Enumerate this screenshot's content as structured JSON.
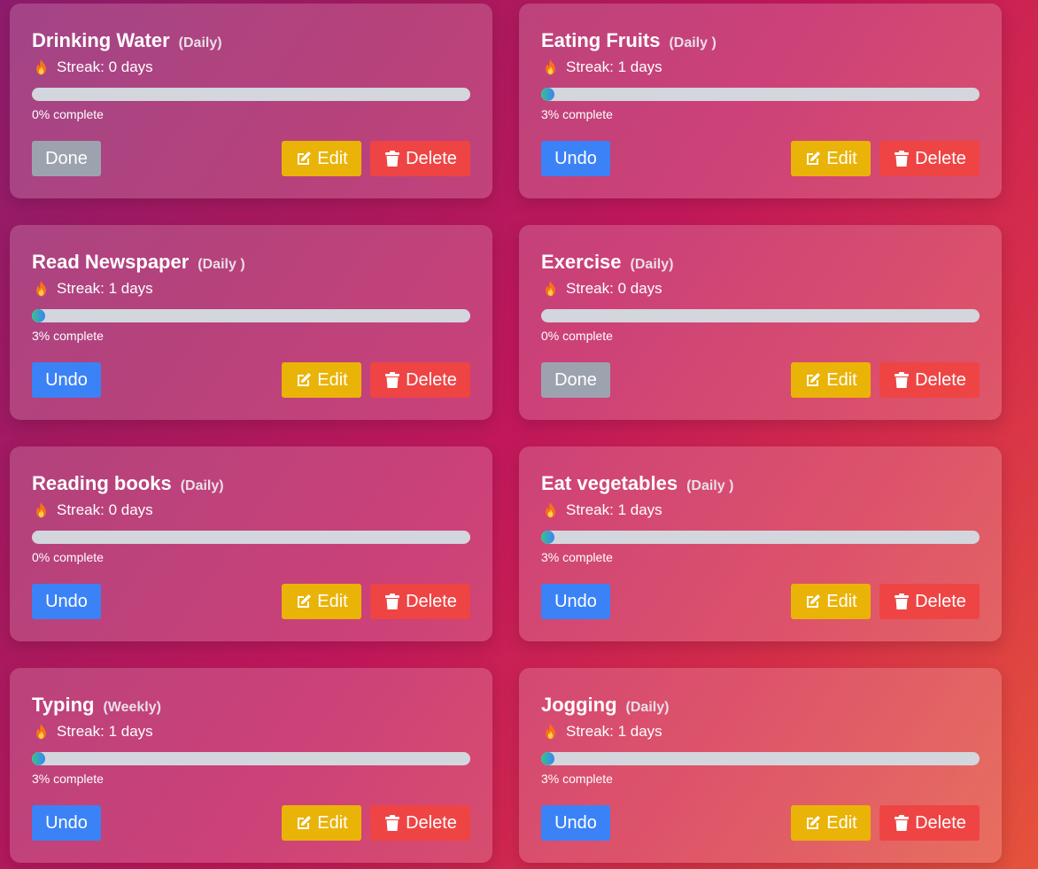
{
  "colors": {
    "done_button": "#9ca3af",
    "undo_button": "#3b82f6",
    "edit_button": "#eab308",
    "delete_button": "#ef4444",
    "progress_track": "#d3d6dc"
  },
  "icons": {
    "streak": "fire-icon",
    "edit": "edit-icon",
    "delete": "trash-icon"
  },
  "habits": [
    {
      "name": "Drinking Water",
      "frequency": "(Daily)",
      "streak": "Streak: 0 days",
      "progress": 0,
      "progress_label": "0% complete",
      "toggle_label": "Done",
      "toggle_state": "done",
      "edit_label": "Edit",
      "delete_label": "Delete"
    },
    {
      "name": "Eating Fruits",
      "frequency": "(Daily )",
      "streak": "Streak: 1 days",
      "progress": 3,
      "progress_label": "3% complete",
      "toggle_label": "Undo",
      "toggle_state": "undo",
      "edit_label": "Edit",
      "delete_label": "Delete"
    },
    {
      "name": "Read Newspaper",
      "frequency": "(Daily )",
      "streak": "Streak: 1 days",
      "progress": 3,
      "progress_label": "3% complete",
      "toggle_label": "Undo",
      "toggle_state": "undo",
      "edit_label": "Edit",
      "delete_label": "Delete"
    },
    {
      "name": "Exercise",
      "frequency": "(Daily)",
      "streak": "Streak: 0 days",
      "progress": 0,
      "progress_label": "0% complete",
      "toggle_label": "Done",
      "toggle_state": "done",
      "edit_label": "Edit",
      "delete_label": "Delete"
    },
    {
      "name": "Reading books",
      "frequency": "(Daily)",
      "streak": "Streak: 0 days",
      "progress": 0,
      "progress_label": "0% complete",
      "toggle_label": "Undo",
      "toggle_state": "undo",
      "edit_label": "Edit",
      "delete_label": "Delete"
    },
    {
      "name": "Eat vegetables",
      "frequency": "(Daily )",
      "streak": "Streak: 1 days",
      "progress": 3,
      "progress_label": "3% complete",
      "toggle_label": "Undo",
      "toggle_state": "undo",
      "edit_label": "Edit",
      "delete_label": "Delete"
    },
    {
      "name": "Typing",
      "frequency": "(Weekly)",
      "streak": "Streak: 1 days",
      "progress": 3,
      "progress_label": "3% complete",
      "toggle_label": "Undo",
      "toggle_state": "undo",
      "edit_label": "Edit",
      "delete_label": "Delete"
    },
    {
      "name": "Jogging",
      "frequency": "(Daily)",
      "streak": "Streak: 1 days",
      "progress": 3,
      "progress_label": "3% complete",
      "toggle_label": "Undo",
      "toggle_state": "undo",
      "edit_label": "Edit",
      "delete_label": "Delete"
    }
  ]
}
